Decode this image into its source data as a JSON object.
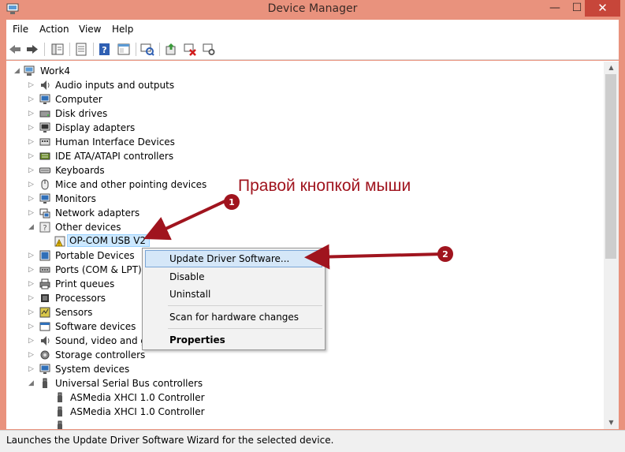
{
  "window": {
    "title": "Device Manager",
    "minimize": "—",
    "maximize": "☐",
    "close": "✕",
    "accent_color": "#e9927d"
  },
  "menu": {
    "items": [
      "File",
      "Action",
      "View",
      "Help"
    ]
  },
  "toolbar": {
    "icons": [
      "back-icon",
      "forward-icon",
      "console-tree-icon",
      "properties-icon",
      "help-icon",
      "show-hide-icon",
      "scan-hardware-icon",
      "update-driver-icon",
      "uninstall-icon",
      "disable-icon"
    ]
  },
  "tree": {
    "root": "Work4",
    "categories": {
      "audio": "Audio inputs and outputs",
      "computer": "Computer",
      "disk": "Disk drives",
      "display": "Display adapters",
      "hid": "Human Interface Devices",
      "ide": "IDE ATA/ATAPI controllers",
      "keyboards": "Keyboards",
      "mice": "Mice and other pointing devices",
      "monitors": "Monitors",
      "network": "Network adapters",
      "other": "Other devices",
      "other_child": "OP-COM USB V2",
      "portable": "Portable Devices",
      "ports": "Ports (COM & LPT)",
      "print": "Print queues",
      "processors": "Processors",
      "sensors": "Sensors",
      "software": "Software devices",
      "sound": "Sound, video and game controllers",
      "storage": "Storage controllers",
      "system": "System devices",
      "usb": "Universal Serial Bus controllers",
      "usb_child_1": "ASMedia XHCI 1.0 Controller",
      "usb_child_2": "ASMedia XHCI 1.0 Controller"
    }
  },
  "context_menu": {
    "update": "Update Driver Software...",
    "disable": "Disable",
    "uninstall": "Uninstall",
    "scan": "Scan for hardware changes",
    "properties": "Properties"
  },
  "annotation": {
    "text": "Правой кнопкой мыши",
    "marker_1": "1",
    "marker_2": "2",
    "color": "#a0141e"
  },
  "status": {
    "text": "Launches the Update Driver Software Wizard for the selected device."
  }
}
